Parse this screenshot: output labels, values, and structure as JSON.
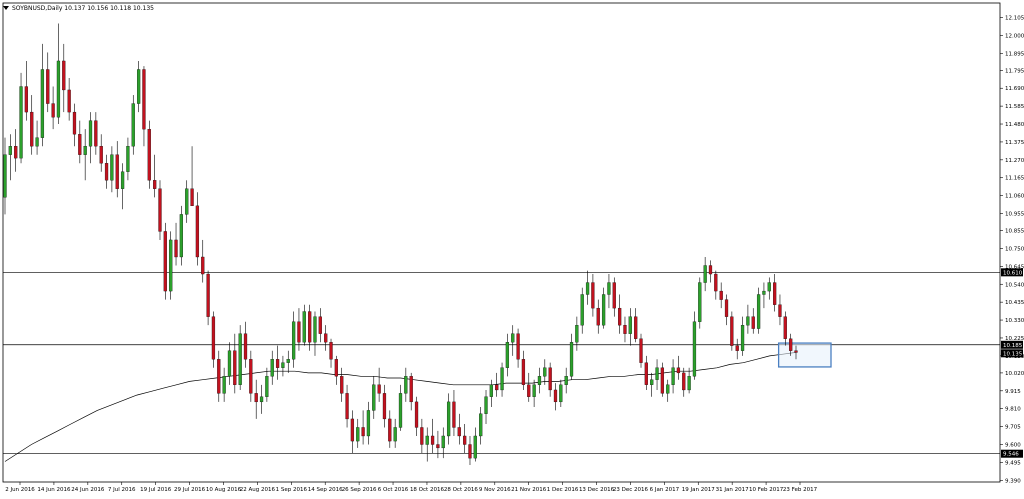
{
  "header": {
    "symbol_line": "SOYBNUSD,Daily  10.137 10.156 10.118 10.135"
  },
  "chart_data": {
    "type": "candlestick",
    "symbol": "SOYBNUSD",
    "timeframe": "Daily",
    "ohlc_header": {
      "open": 10.137,
      "high": 10.156,
      "low": 10.118,
      "close": 10.135
    },
    "ylim": [
      9.38,
      12.19
    ],
    "y_ticks": [
      "12.105",
      "12.000",
      "11.895",
      "11.795",
      "11.690",
      "11.585",
      "11.480",
      "11.375",
      "11.270",
      "11.165",
      "11.060",
      "10.955",
      "10.855",
      "10.750",
      "10.645",
      "10.540",
      "10.435",
      "10.330",
      "10.225",
      "10.120",
      "10.020",
      "9.915",
      "9.810",
      "9.705",
      "9.600",
      "9.495",
      "9.390"
    ],
    "x_ticks": [
      "2 Jun 2016",
      "14 Jun 2016",
      "24 Jun 2016",
      "7 Jul 2016",
      "19 Jul 2016",
      "29 Jul 2016",
      "10 Aug 2016",
      "22 Aug 2016",
      "1 Sep 2016",
      "14 Sep 2016",
      "26 Sep 2016",
      "6 Oct 2016",
      "18 Oct 2016",
      "28 Oct 2016",
      "9 Nov 2016",
      "21 Nov 2016",
      "1 Dec 2016",
      "13 Dec 2016",
      "23 Dec 2016",
      "6 Jan 2017",
      "19 Jan 2017",
      "31 Jan 2017",
      "10 Feb 2017",
      "23 Feb 2017"
    ],
    "colors": {
      "up": "#2ca02c",
      "down": "#c1121f",
      "wick": "#000000",
      "grid_line": "#000000",
      "ma": "#000000",
      "box": "#4a7fc1",
      "box_fill": "#e6f0fb",
      "label_bg": "#000000"
    },
    "levels": [
      {
        "value": 10.61,
        "label": "10.610"
      },
      {
        "value": 10.185,
        "label": "10.185"
      },
      {
        "value": 9.546,
        "label": "9.546"
      }
    ],
    "current_price": {
      "value": 10.135,
      "label": "10.135"
    },
    "highlight_box": {
      "y_top": 10.195,
      "y_bottom": 10.055
    },
    "candles": [
      [
        11.05,
        11.4,
        10.95,
        11.3
      ],
      [
        11.3,
        11.42,
        11.15,
        11.35
      ],
      [
        11.35,
        11.45,
        11.2,
        11.28
      ],
      [
        11.28,
        11.78,
        11.25,
        11.7
      ],
      [
        11.7,
        11.85,
        11.5,
        11.55
      ],
      [
        11.55,
        11.65,
        11.3,
        11.35
      ],
      [
        11.35,
        11.5,
        11.3,
        11.4
      ],
      [
        11.4,
        11.95,
        11.35,
        11.8
      ],
      [
        11.8,
        11.9,
        11.55,
        11.6
      ],
      [
        11.6,
        11.7,
        11.45,
        11.52
      ],
      [
        11.52,
        12.07,
        11.48,
        11.85
      ],
      [
        11.85,
        11.95,
        11.55,
        11.68
      ],
      [
        11.68,
        11.75,
        11.5,
        11.55
      ],
      [
        11.55,
        11.6,
        11.35,
        11.42
      ],
      [
        11.42,
        11.5,
        11.25,
        11.3
      ],
      [
        11.3,
        11.45,
        11.15,
        11.35
      ],
      [
        11.35,
        11.55,
        11.25,
        11.5
      ],
      [
        11.5,
        11.55,
        11.3,
        11.35
      ],
      [
        11.35,
        11.42,
        11.2,
        11.25
      ],
      [
        11.25,
        11.3,
        11.1,
        11.15
      ],
      [
        11.15,
        11.35,
        11.08,
        11.3
      ],
      [
        11.3,
        11.38,
        11.05,
        11.1
      ],
      [
        11.1,
        11.25,
        10.98,
        11.2
      ],
      [
        11.2,
        11.4,
        11.15,
        11.35
      ],
      [
        11.35,
        11.65,
        11.3,
        11.6
      ],
      [
        11.6,
        11.85,
        11.55,
        11.8
      ],
      [
        11.8,
        11.82,
        11.35,
        11.45
      ],
      [
        11.45,
        11.5,
        11.1,
        11.15
      ],
      [
        11.15,
        11.3,
        11.05,
        11.1
      ],
      [
        11.1,
        11.15,
        10.8,
        10.85
      ],
      [
        10.85,
        10.9,
        10.45,
        10.5
      ],
      [
        10.5,
        10.85,
        10.45,
        10.8
      ],
      [
        10.8,
        10.9,
        10.65,
        10.7
      ],
      [
        10.7,
        11.0,
        10.65,
        10.95
      ],
      [
        10.95,
        11.15,
        10.9,
        11.1
      ],
      [
        11.1,
        11.35,
        11.0,
        11.0
      ],
      [
        11.0,
        11.08,
        10.65,
        10.7
      ],
      [
        10.7,
        10.8,
        10.55,
        10.6
      ],
      [
        10.6,
        10.62,
        10.3,
        10.35
      ],
      [
        10.35,
        10.38,
        10.05,
        10.1
      ],
      [
        10.1,
        10.15,
        9.85,
        9.9
      ],
      [
        9.9,
        10.05,
        9.85,
        10.0
      ],
      [
        10.0,
        10.2,
        9.95,
        10.15
      ],
      [
        10.15,
        10.25,
        9.9,
        9.95
      ],
      [
        9.95,
        10.3,
        9.92,
        10.25
      ],
      [
        10.25,
        10.32,
        10.05,
        10.1
      ],
      [
        10.1,
        10.15,
        9.85,
        9.9
      ],
      [
        9.9,
        9.98,
        9.75,
        9.85
      ],
      [
        9.85,
        9.95,
        9.78,
        9.88
      ],
      [
        9.88,
        10.05,
        9.85,
        10.0
      ],
      [
        10.0,
        10.15,
        9.95,
        10.1
      ],
      [
        10.1,
        10.18,
        9.98,
        10.05
      ],
      [
        10.05,
        10.12,
        10.0,
        10.08
      ],
      [
        10.08,
        10.15,
        10.02,
        10.1
      ],
      [
        10.1,
        10.38,
        10.05,
        10.32
      ],
      [
        10.32,
        10.4,
        10.15,
        10.2
      ],
      [
        10.2,
        10.42,
        10.18,
        10.38
      ],
      [
        10.38,
        10.42,
        10.15,
        10.2
      ],
      [
        10.2,
        10.38,
        10.12,
        10.35
      ],
      [
        10.35,
        10.4,
        10.2,
        10.25
      ],
      [
        10.25,
        10.3,
        10.15,
        10.2
      ],
      [
        10.2,
        10.22,
        10.05,
        10.1
      ],
      [
        10.1,
        10.12,
        9.95,
        10.0
      ],
      [
        10.0,
        10.05,
        9.85,
        9.9
      ],
      [
        9.9,
        9.95,
        9.7,
        9.75
      ],
      [
        9.75,
        9.8,
        9.55,
        9.62
      ],
      [
        9.62,
        9.75,
        9.58,
        9.7
      ],
      [
        9.7,
        9.8,
        9.6,
        9.65
      ],
      [
        9.65,
        9.85,
        9.6,
        9.8
      ],
      [
        9.8,
        10.0,
        9.75,
        9.95
      ],
      [
        9.95,
        10.05,
        9.85,
        9.9
      ],
      [
        9.9,
        9.95,
        9.7,
        9.75
      ],
      [
        9.75,
        9.8,
        9.58,
        9.62
      ],
      [
        9.62,
        9.75,
        9.58,
        9.7
      ],
      [
        9.7,
        9.95,
        9.68,
        9.9
      ],
      [
        9.9,
        10.05,
        9.85,
        10.0
      ],
      [
        10.0,
        10.02,
        9.8,
        9.85
      ],
      [
        9.85,
        9.88,
        9.65,
        9.7
      ],
      [
        9.7,
        9.75,
        9.55,
        9.6
      ],
      [
        9.6,
        9.7,
        9.5,
        9.65
      ],
      [
        9.65,
        9.75,
        9.55,
        9.6
      ],
      [
        9.6,
        9.68,
        9.52,
        9.58
      ],
      [
        9.58,
        9.7,
        9.52,
        9.65
      ],
      [
        9.65,
        9.9,
        9.6,
        9.85
      ],
      [
        9.85,
        9.92,
        9.65,
        9.7
      ],
      [
        9.7,
        9.78,
        9.6,
        9.65
      ],
      [
        9.65,
        9.72,
        9.55,
        9.6
      ],
      [
        9.6,
        9.65,
        9.48,
        9.52
      ],
      [
        9.52,
        9.7,
        9.5,
        9.65
      ],
      [
        9.65,
        9.82,
        9.6,
        9.78
      ],
      [
        9.78,
        9.92,
        9.72,
        9.88
      ],
      [
        9.88,
        9.98,
        9.82,
        9.95
      ],
      [
        9.95,
        10.02,
        9.88,
        9.92
      ],
      [
        9.92,
        10.08,
        9.88,
        10.05
      ],
      [
        10.05,
        10.25,
        10.0,
        10.2
      ],
      [
        10.2,
        10.3,
        10.12,
        10.25
      ],
      [
        10.25,
        10.28,
        10.05,
        10.1
      ],
      [
        10.1,
        10.15,
        9.92,
        9.95
      ],
      [
        9.95,
        10.02,
        9.85,
        9.88
      ],
      [
        9.88,
        9.98,
        9.82,
        9.95
      ],
      [
        9.95,
        10.05,
        9.9,
        10.0
      ],
      [
        10.0,
        10.1,
        9.95,
        10.05
      ],
      [
        10.05,
        10.08,
        9.88,
        9.92
      ],
      [
        9.92,
        9.96,
        9.8,
        9.85
      ],
      [
        9.85,
        9.98,
        9.82,
        9.95
      ],
      [
        9.95,
        10.05,
        9.9,
        10.0
      ],
      [
        10.0,
        10.25,
        9.98,
        10.2
      ],
      [
        10.2,
        10.35,
        10.15,
        10.3
      ],
      [
        10.3,
        10.52,
        10.25,
        10.48
      ],
      [
        10.48,
        10.62,
        10.42,
        10.55
      ],
      [
        10.55,
        10.6,
        10.35,
        10.4
      ],
      [
        10.4,
        10.45,
        10.25,
        10.3
      ],
      [
        10.3,
        10.52,
        10.28,
        10.48
      ],
      [
        10.48,
        10.6,
        10.4,
        10.55
      ],
      [
        10.55,
        10.58,
        10.35,
        10.4
      ],
      [
        10.4,
        10.48,
        10.25,
        10.3
      ],
      [
        10.3,
        10.35,
        10.2,
        10.25
      ],
      [
        10.25,
        10.4,
        10.18,
        10.35
      ],
      [
        10.35,
        10.4,
        10.2,
        10.22
      ],
      [
        10.22,
        10.25,
        10.05,
        10.08
      ],
      [
        10.08,
        10.12,
        9.92,
        9.95
      ],
      [
        9.95,
        10.02,
        9.88,
        9.98
      ],
      [
        9.98,
        10.1,
        9.92,
        10.05
      ],
      [
        10.05,
        10.08,
        9.88,
        9.9
      ],
      [
        9.9,
        9.98,
        9.85,
        9.95
      ],
      [
        9.95,
        10.1,
        9.9,
        10.05
      ],
      [
        10.05,
        10.12,
        9.98,
        10.02
      ],
      [
        10.02,
        10.05,
        9.88,
        9.92
      ],
      [
        9.92,
        10.05,
        9.9,
        10.0
      ],
      [
        10.0,
        10.38,
        9.98,
        10.32
      ],
      [
        10.32,
        10.58,
        10.28,
        10.55
      ],
      [
        10.55,
        10.7,
        10.5,
        10.65
      ],
      [
        10.65,
        10.68,
        10.55,
        10.6
      ],
      [
        10.6,
        10.62,
        10.45,
        10.5
      ],
      [
        10.5,
        10.55,
        10.4,
        10.45
      ],
      [
        10.45,
        10.48,
        10.3,
        10.35
      ],
      [
        10.35,
        10.38,
        10.15,
        10.18
      ],
      [
        10.18,
        10.22,
        10.1,
        10.15
      ],
      [
        10.15,
        10.35,
        10.12,
        10.3
      ],
      [
        10.3,
        10.42,
        10.25,
        10.35
      ],
      [
        10.35,
        10.4,
        10.25,
        10.28
      ],
      [
        10.28,
        10.52,
        10.25,
        10.48
      ],
      [
        10.48,
        10.55,
        10.4,
        10.5
      ],
      [
        10.5,
        10.58,
        10.45,
        10.55
      ],
      [
        10.55,
        10.6,
        10.38,
        10.42
      ],
      [
        10.42,
        10.48,
        10.3,
        10.35
      ],
      [
        10.35,
        10.38,
        10.18,
        10.22
      ],
      [
        10.22,
        10.25,
        10.12,
        10.15
      ],
      [
        10.15,
        10.18,
        10.1,
        10.14
      ]
    ],
    "ma_points": [
      9.5,
      9.55,
      9.6,
      9.64,
      9.68,
      9.72,
      9.76,
      9.8,
      9.83,
      9.86,
      9.89,
      9.91,
      9.93,
      9.95,
      9.97,
      9.98,
      9.99,
      10.0,
      10.01,
      10.02,
      10.03,
      10.03,
      10.03,
      10.02,
      10.02,
      10.01,
      10.01,
      10.0,
      10.0,
      9.99,
      9.99,
      9.98,
      9.97,
      9.96,
      9.95,
      9.95,
      9.95,
      9.95,
      9.96,
      9.96,
      9.96,
      9.97,
      9.97,
      9.98,
      9.98,
      9.99,
      10.0,
      10.0,
      10.01,
      10.01,
      10.02,
      10.03,
      10.03,
      10.04,
      10.05,
      10.07,
      10.08,
      10.1,
      10.12,
      10.13,
      10.14
    ]
  }
}
